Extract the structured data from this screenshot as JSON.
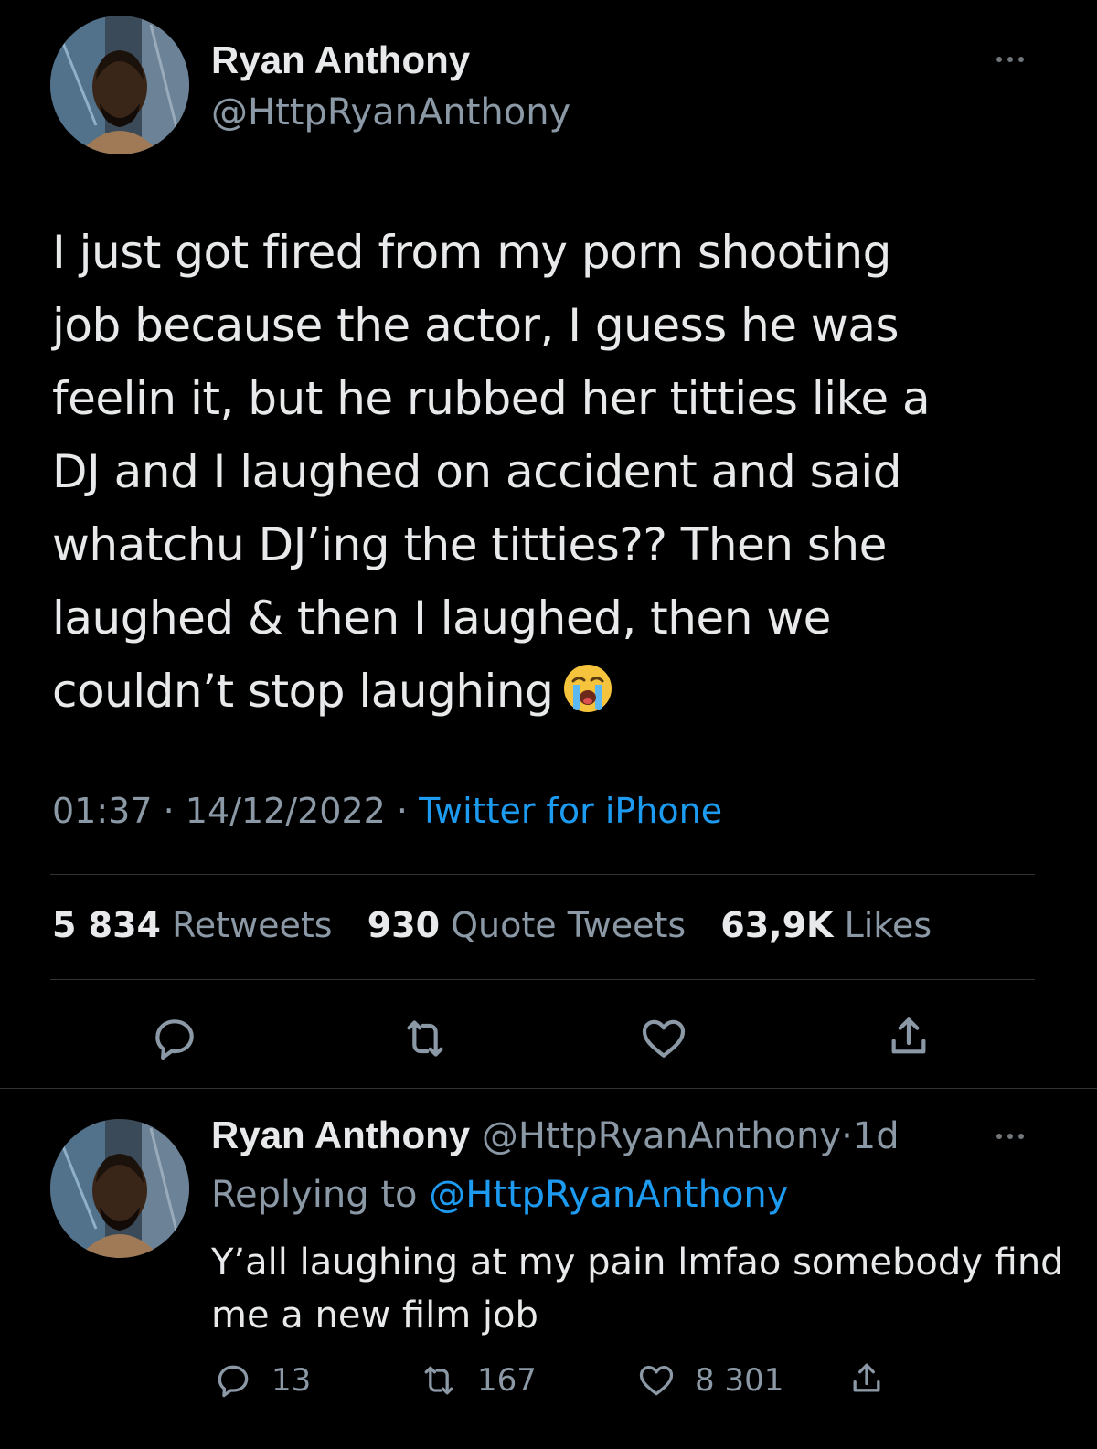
{
  "tweet": {
    "author_name": "Ryan Anthony",
    "author_handle": "@HttpRyanAnthony",
    "text_lines": [
      "I just got fired from my porn shooting",
      "job because the actor, I guess he was",
      "feelin it, but he rubbed her titties like a",
      "DJ and I laughed on accident and said",
      "whatchu DJ’ing the titties?? Then she",
      "laughed & then I laughed, then we",
      "couldn’t stop laughing"
    ],
    "emoji": "loudly-crying-face",
    "time": "01:37",
    "date": "14/12/2022",
    "separator": "·",
    "source": "Twitter for iPhone",
    "stats": {
      "retweets_count": "5 834",
      "retweets_label": "Retweets",
      "quotes_count": "930",
      "quotes_label": "Quote Tweets",
      "likes_count": "63,9K",
      "likes_label": "Likes"
    },
    "actions": [
      "reply-icon",
      "retweet-icon",
      "like-icon",
      "share-icon"
    ]
  },
  "reply": {
    "author_name": "Ryan Anthony",
    "author_handle": "@HttpRyanAnthony",
    "age": "1d",
    "replying_label": "Replying to",
    "replying_to": "@HttpRyanAnthony",
    "text_lines": [
      "Y’all laughing at my pain lmfao somebody find",
      "me a new film job"
    ],
    "reply_count": "13",
    "retweet_count": "167",
    "like_count": "8 301"
  },
  "colors": {
    "background": "#000000",
    "text": "#e7e9ea",
    "secondary": "#8b98a5",
    "accent": "#1d9bf0",
    "divider": "#2f3336"
  }
}
